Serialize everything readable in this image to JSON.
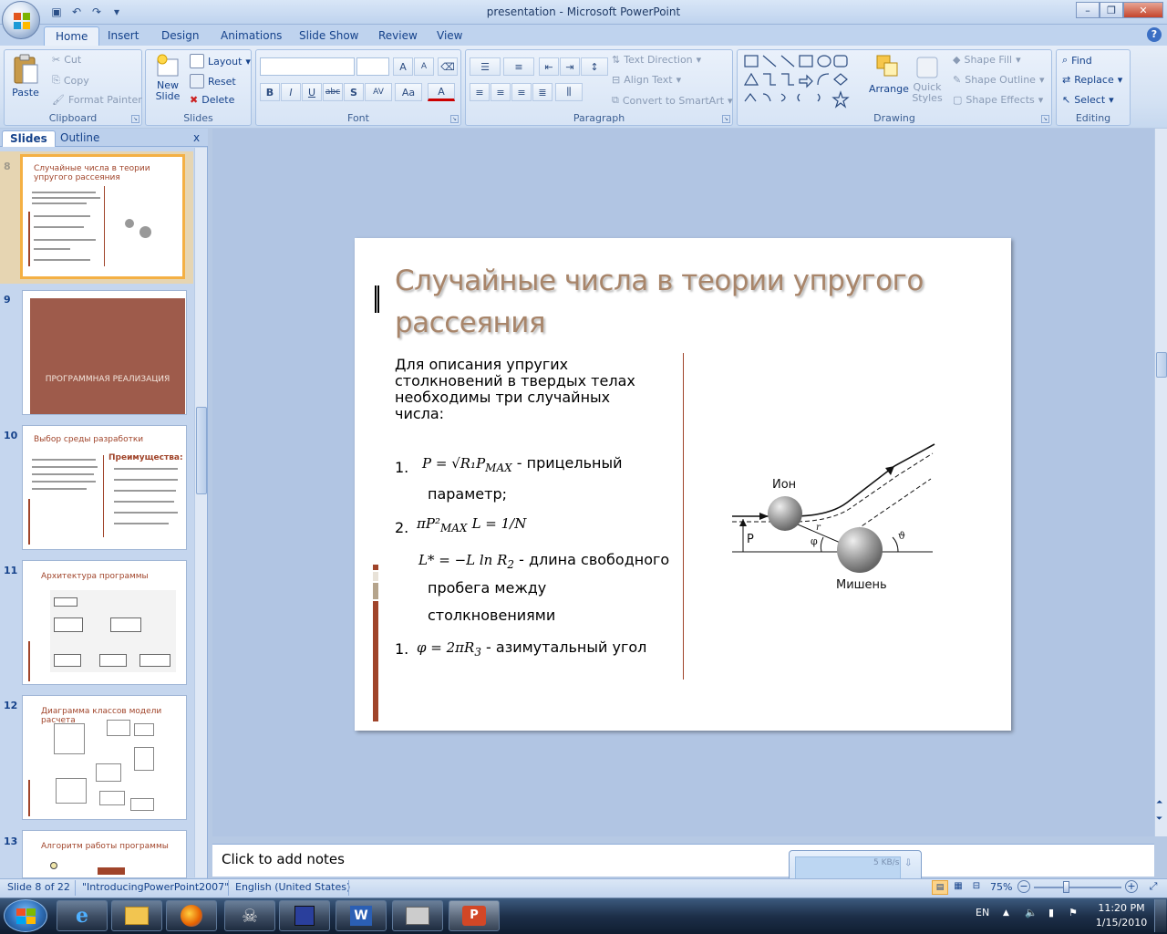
{
  "window": {
    "title": "presentation - Microsoft PowerPoint"
  },
  "ribbon": {
    "tabs": [
      "Home",
      "Insert",
      "Design",
      "Animations",
      "Slide Show",
      "Review",
      "View"
    ],
    "clipboard": {
      "paste": "Paste",
      "cut": "Cut",
      "copy": "Copy",
      "format_painter": "Format Painter",
      "label": "Clipboard"
    },
    "slides": {
      "new_slide": "New Slide",
      "layout": "Layout",
      "reset": "Reset",
      "delete": "Delete",
      "label": "Slides"
    },
    "font": {
      "label": "Font",
      "bold": "B",
      "italic": "I",
      "underline": "U",
      "strike": "abc",
      "shadow": "S",
      "spacing": "AV",
      "case": "Aa",
      "color": "A",
      "grow": "A",
      "shrink": "A"
    },
    "paragraph": {
      "text_direction": "Text Direction",
      "align_text": "Align Text",
      "convert_smartart": "Convert to SmartArt",
      "label": "Paragraph"
    },
    "drawing": {
      "arrange": "Arrange",
      "quick_styles": "Quick Styles",
      "shape_fill": "Shape Fill",
      "shape_outline": "Shape Outline",
      "shape_effects": "Shape Effects",
      "label": "Drawing"
    },
    "editing": {
      "find": "Find",
      "replace": "Replace",
      "select": "Select",
      "label": "Editing"
    }
  },
  "pane": {
    "tabs": [
      "Slides",
      "Outline"
    ],
    "close": "x",
    "thumbs": [
      {
        "num": "8",
        "title": "Случайные числа в теории упругого рассеяния"
      },
      {
        "num": "9",
        "title": "ПРОГРАММНАЯ РЕАЛИЗАЦИЯ"
      },
      {
        "num": "10",
        "title": "Выбор среды разработки",
        "sub": "Преимущества:"
      },
      {
        "num": "11",
        "title": "Архитектура программы"
      },
      {
        "num": "12",
        "title": "Диаграмма классов модели расчета"
      },
      {
        "num": "13",
        "title": "Алгоритм работы программы"
      }
    ]
  },
  "slide": {
    "title": "Случайные числа в теории упругого рассеяния",
    "intro": "Для описания упругих столкновений в твердых телах необходимы три случайных числа:",
    "item1_num": "1.",
    "item1_formula": "P = √R₁P",
    "item1_sub": "MAX",
    "item1_text": " - прицельный",
    "item1_text2": "параметр;",
    "item2_num": "2.",
    "item2_formula": "πP²",
    "item2_sub": "MAX",
    "item2_formula_b": "L = 1/N",
    "item2_formula2": "L* = −L ln R",
    "item2_formula2_sub": "2",
    "item2_text": " - длина свободного",
    "item2_text2": "пробега между",
    "item2_text3": "столкновениями",
    "item3_num": "1.",
    "item3_formula": "φ = 2πR",
    "item3_sub": "3",
    "item3_text": " - азимутальный угол",
    "diagram": {
      "ion": "Ион",
      "target": "Мишень",
      "p": "P",
      "phi": "φ",
      "theta": "ϑ",
      "r": "r"
    }
  },
  "notes": {
    "placeholder": "Click to add notes"
  },
  "status": {
    "slide": "Slide 8 of 22",
    "theme": "\"IntroducingPowerPoint2007\"",
    "language": "English (United States)",
    "zoom": "75%",
    "net": "5 KB/s"
  },
  "taskbar": {
    "lang": "EN",
    "time": "11:20 PM",
    "date": "1/15/2010"
  }
}
